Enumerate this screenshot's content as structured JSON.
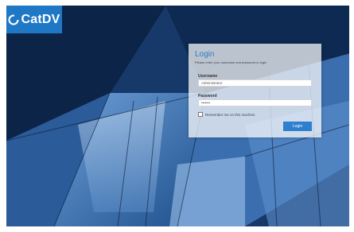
{
  "brand": {
    "name": "CatDV",
    "color": "#1f78c6"
  },
  "login": {
    "title": "Login",
    "subtitle": "Please enter your username and password to login",
    "username_label": "Username",
    "username_value": "Administrator",
    "password_label": "Password",
    "password_value": "•••••••",
    "remember_label": "Remember me on this machine",
    "remember_checked": false,
    "submit_label": "Login",
    "accent_color": "#2f7fcf"
  }
}
